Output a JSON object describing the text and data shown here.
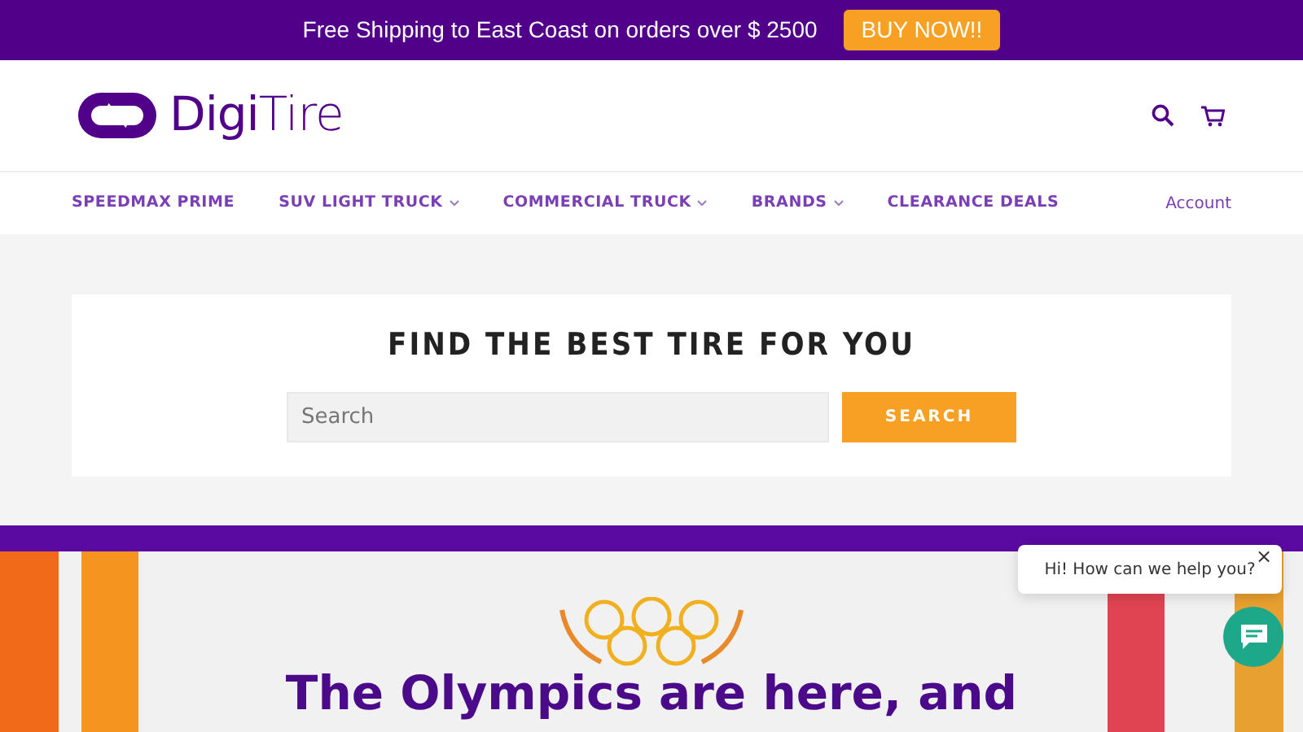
{
  "announcement": {
    "text": "Free Shipping to East Coast on orders over $ 2500",
    "button": "BUY NOW!!"
  },
  "logo": {
    "text": "**Digi**Tire"
  },
  "nav": [
    {
      "label": "SPEEDMAX PRIME",
      "dropdown": false
    },
    {
      "label": "SUV LIGHT TRUCK",
      "dropdown": true
    },
    {
      "label": "COMMERCIAL TRUCK",
      "dropdown": true
    },
    {
      "label": "BRANDS",
      "dropdown": true
    },
    {
      "label": "CLEARANCE DEALS",
      "dropdown": false
    }
  ],
  "account": "Account",
  "search": {
    "title": "FIND THE BEST TIRE FOR YOU",
    "placeholder": "Search",
    "button": "SEARCH"
  },
  "hero": {
    "headline": "The Olympics are here, and"
  },
  "chat": {
    "message": "Hi! How can we help you?",
    "close": "×"
  }
}
